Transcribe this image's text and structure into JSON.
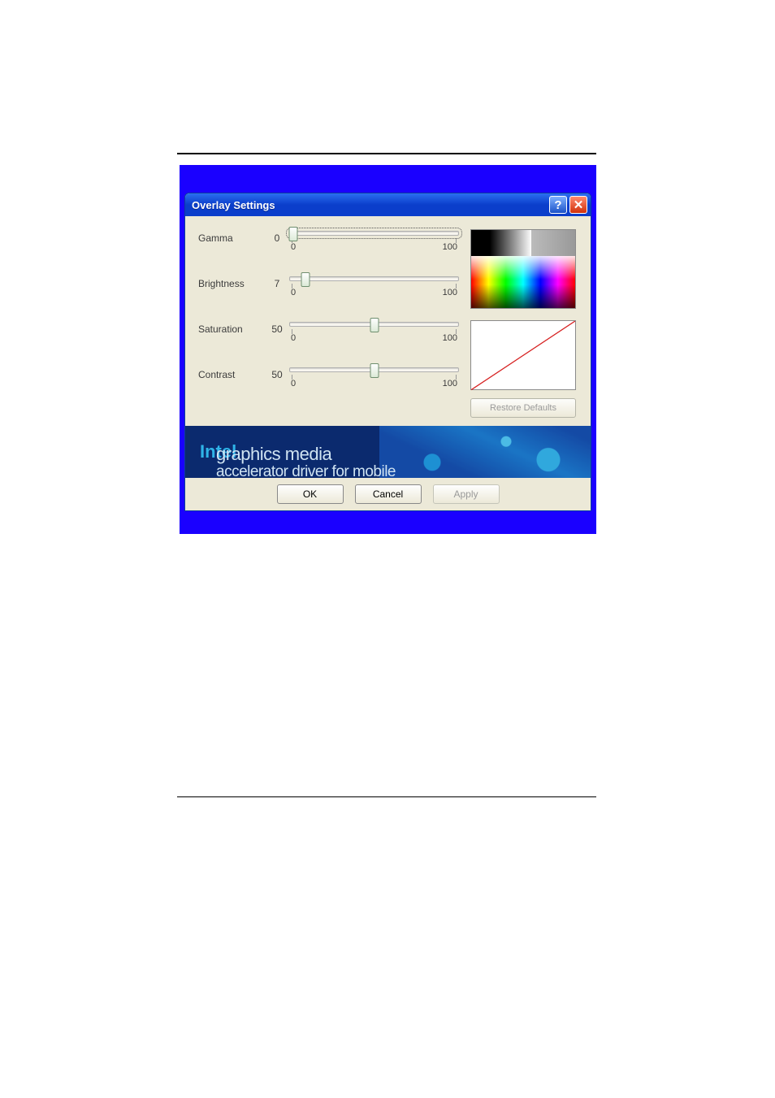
{
  "title": "Overlay Settings",
  "titlebar": {
    "help_label": "?",
    "close_label": "✕"
  },
  "sliders": [
    {
      "label": "Gamma",
      "value": 0,
      "min_label": "0",
      "max_label": "100",
      "thumb_pct": 2,
      "focused": true
    },
    {
      "label": "Brightness",
      "value": 7,
      "min_label": "0",
      "max_label": "100",
      "thumb_pct": 9,
      "focused": false
    },
    {
      "label": "Saturation",
      "value": 50,
      "min_label": "0",
      "max_label": "100",
      "thumb_pct": 50,
      "focused": false
    },
    {
      "label": "Contrast",
      "value": 50,
      "min_label": "0",
      "max_label": "100",
      "thumb_pct": 50,
      "focused": false
    }
  ],
  "restore_label": "Restore Defaults",
  "brand": {
    "intel": "Intel",
    "line1": "graphics media",
    "line2": "accelerator driver for mobile"
  },
  "buttons": {
    "ok": "OK",
    "cancel": "Cancel",
    "apply": "Apply"
  }
}
